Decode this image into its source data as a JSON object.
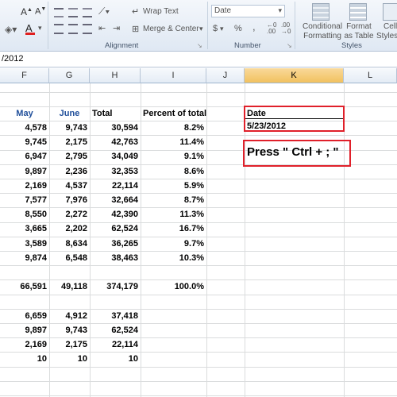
{
  "ribbon": {
    "wrap_text": "Wrap Text",
    "merge_center": "Merge & Center",
    "number_format": "Date",
    "currency_symbol": "$",
    "percent_symbol": "%",
    "comma_symbol": ",",
    "conditional_formatting": [
      "Conditional",
      "Formatting"
    ],
    "format_as_table": [
      "Format",
      "as Table"
    ],
    "cell_styles": [
      "Cell",
      "Styles"
    ],
    "alignment_label": "Alignment",
    "number_label": "Number",
    "styles_label": "Styles",
    "font_color": "#e02020"
  },
  "formula_bar": {
    "value": "/2012"
  },
  "columns": [
    {
      "label": "F",
      "selected": false
    },
    {
      "label": "G",
      "selected": false
    },
    {
      "label": "H",
      "selected": false
    },
    {
      "label": "I",
      "selected": false
    },
    {
      "label": "J",
      "selected": false
    },
    {
      "label": "K",
      "selected": true
    },
    {
      "label": "L",
      "selected": false
    }
  ],
  "table": {
    "headers": {
      "may": "May",
      "june": "June",
      "total": "Total",
      "percent": "Percent of total"
    },
    "rows": [
      {
        "may": "4,578",
        "june": "9,743",
        "total": "30,594",
        "percent": "8.2%"
      },
      {
        "may": "9,745",
        "june": "2,175",
        "total": "42,763",
        "percent": "11.4%"
      },
      {
        "may": "6,947",
        "june": "2,795",
        "total": "34,049",
        "percent": "9.1%"
      },
      {
        "may": "9,897",
        "june": "2,236",
        "total": "32,353",
        "percent": "8.6%"
      },
      {
        "may": "2,169",
        "june": "4,537",
        "total": "22,114",
        "percent": "5.9%"
      },
      {
        "may": "7,577",
        "june": "7,976",
        "total": "32,664",
        "percent": "8.7%"
      },
      {
        "may": "8,550",
        "june": "2,272",
        "total": "42,390",
        "percent": "11.3%"
      },
      {
        "may": "3,665",
        "june": "2,202",
        "total": "62,524",
        "percent": "16.7%"
      },
      {
        "may": "3,589",
        "june": "8,634",
        "total": "36,265",
        "percent": "9.7%"
      },
      {
        "may": "9,874",
        "june": "6,548",
        "total": "38,463",
        "percent": "10.3%"
      }
    ],
    "totals": {
      "may": "66,591",
      "june": "49,118",
      "total": "374,179",
      "percent": "100.0%"
    },
    "stats": [
      {
        "may": "6,659",
        "june": "4,912",
        "total": "37,418"
      },
      {
        "may": "9,897",
        "june": "9,743",
        "total": "62,524"
      },
      {
        "may": "2,169",
        "june": "2,175",
        "total": "22,114"
      },
      {
        "may": "10",
        "june": "10",
        "total": "10"
      }
    ]
  },
  "date_box": {
    "label": "Date",
    "value": "5/23/2012"
  },
  "instruction": "Press \" Ctrl + ; \""
}
